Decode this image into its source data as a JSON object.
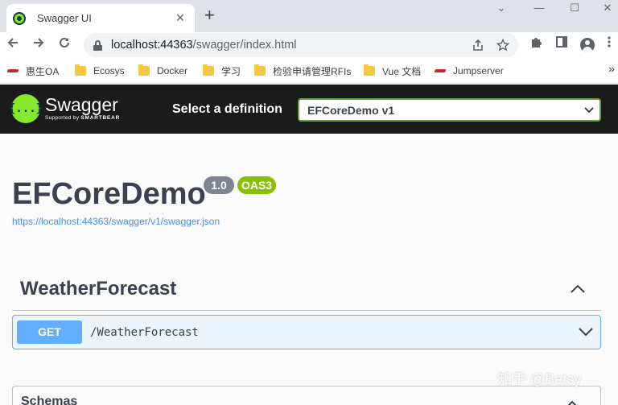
{
  "browser": {
    "tab_title": "Swagger UI",
    "tab_close": "✕",
    "new_tab": "+",
    "window_controls": {
      "minimize": "—",
      "maximize": "☐",
      "close": "✕",
      "dropdown": "⌄"
    },
    "url_host": "localhost:44363",
    "url_path": "/swagger/index.html",
    "bookmarks": [
      {
        "label": "惠生OA",
        "icon": "site-icon"
      },
      {
        "label": "Ecosys",
        "icon": "folder-icon"
      },
      {
        "label": "Docker",
        "icon": "folder-icon"
      },
      {
        "label": "学习",
        "icon": "folder-icon"
      },
      {
        "label": "检验申请管理RFIs",
        "icon": "folder-icon"
      },
      {
        "label": "Vue 文档",
        "icon": "folder-icon"
      },
      {
        "label": "Jumpserver",
        "icon": "site-icon"
      }
    ],
    "bookmarks_more": "»"
  },
  "topbar": {
    "logo_name": "Swagger",
    "logo_symbol": "{...}",
    "logo_sub_prefix": "Supported by",
    "logo_sub_brand": "SMARTBEAR",
    "select_label": "Select a definition",
    "select_value": "EFCoreDemo v1"
  },
  "info": {
    "title": "EFCoreDemo",
    "version": "1.0",
    "oas": "OAS3",
    "spec_url": "https://localhost:44363/swagger/v1/swagger.json"
  },
  "operations": {
    "tag": "WeatherForecast",
    "method": "GET",
    "path": "/WeatherForecast"
  },
  "schemas": {
    "title": "Schemas"
  },
  "watermark": "知乎 @Betsy",
  "colors": {
    "swagger_green": "#85ea2d",
    "get_blue": "#61affe",
    "badge_gray": "#7d8492",
    "oas_green": "#89bf04",
    "link_blue": "#4990e2"
  }
}
